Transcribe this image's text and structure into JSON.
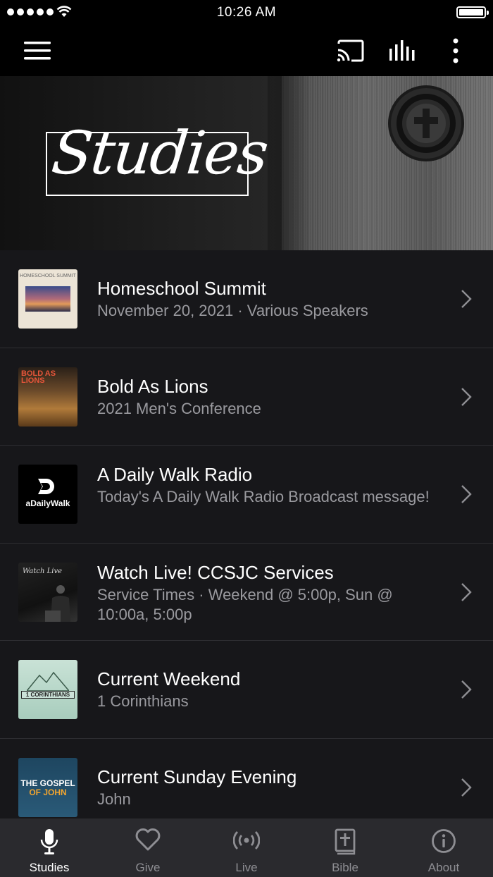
{
  "status_bar": {
    "time": "10:26 AM"
  },
  "banner": {
    "title": "Studies"
  },
  "items": [
    {
      "title": "Homeschool Summit",
      "subtitle": "November 20, 2021 · Various Speakers",
      "thumb_label": "HOMESCHOOL SUMMIT"
    },
    {
      "title": "Bold As Lions",
      "subtitle": "2021 Men's Conference",
      "thumb_label": "BOLD AS LIONS"
    },
    {
      "title": "A Daily Walk Radio",
      "subtitle": "Today's A Daily Walk Radio Broadcast message!",
      "thumb_label": "aDailyWalk"
    },
    {
      "title": "Watch Live! CCSJC Services",
      "subtitle": "Service Times · Weekend @ 5:00p, Sun @ 10:00a, 5:00p",
      "thumb_label": "Watch Live"
    },
    {
      "title": "Current Weekend",
      "subtitle": "1 Corinthians",
      "thumb_label": "1 CORINTHIANS"
    },
    {
      "title": "Current Sunday Evening",
      "subtitle": "John",
      "thumb_label_1": "THE GOSPEL",
      "thumb_label_2": "OF JOHN"
    }
  ],
  "tabs": [
    {
      "label": "Studies",
      "icon": "microphone-icon",
      "active": true
    },
    {
      "label": "Give",
      "icon": "heart-icon"
    },
    {
      "label": "Live",
      "icon": "broadcast-icon"
    },
    {
      "label": "Bible",
      "icon": "bible-icon"
    },
    {
      "label": "About",
      "icon": "info-icon"
    }
  ],
  "colors": {
    "background": "#17171a",
    "tab_bar": "#2a2a2e",
    "subtitle": "#9a9a9f",
    "active_tab": "#ffffff",
    "inactive_tab": "#8e8e93"
  }
}
